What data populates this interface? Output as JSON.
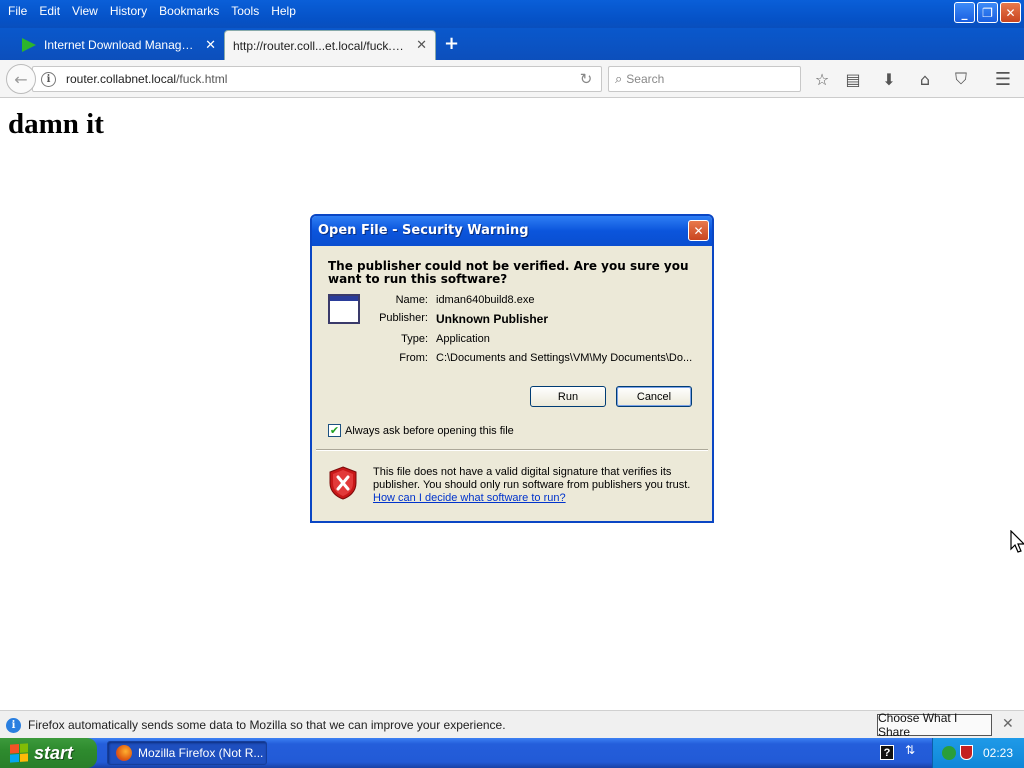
{
  "menubar": {
    "items": [
      "File",
      "Edit",
      "View",
      "History",
      "Bookmarks",
      "Tools",
      "Help"
    ]
  },
  "tabs": [
    {
      "title": "Internet Download Manager: ...",
      "icon": "idm-icon"
    },
    {
      "title": "http://router.coll...et.local/fuck.html",
      "icon": null
    }
  ],
  "navbar": {
    "url_host": "router.collabnet.local",
    "url_path": "/fuck.html",
    "search_placeholder": "Search"
  },
  "page": {
    "heading": "damn it"
  },
  "dialog": {
    "title": "Open File - Security Warning",
    "question": "The publisher could not be verified.  Are you sure you want to run this software?",
    "fields": [
      {
        "label": "Name:",
        "value": "idman640build8.exe",
        "bold": false
      },
      {
        "label": "Publisher:",
        "value": "Unknown Publisher",
        "bold": true
      },
      {
        "label": "Type:",
        "value": "Application",
        "bold": false
      },
      {
        "label": "From:",
        "value": "C:\\Documents and Settings\\VM\\My Documents\\Do...",
        "bold": false
      }
    ],
    "run_label": "Run",
    "cancel_label": "Cancel",
    "always_ask_label": "Always ask before opening this file",
    "always_ask_checked": true,
    "warning_text": "This file does not have a valid digital signature that verifies its publisher.  You should only run software from publishers you trust.",
    "help_link": "How can I decide what software to run?"
  },
  "notification": {
    "text": "Firefox automatically sends some data to Mozilla so that we can improve your experience.",
    "button_label": "Choose What I Share"
  },
  "taskbar": {
    "start_label": "start",
    "window_label": "Mozilla Firefox (Not R...",
    "clock": "02:23"
  },
  "colors": {
    "titlebar_blue": "#0552c7",
    "dialog_bg": "#ece9d8",
    "start_green": "#2e8b2e",
    "link_blue": "#0033cc"
  }
}
